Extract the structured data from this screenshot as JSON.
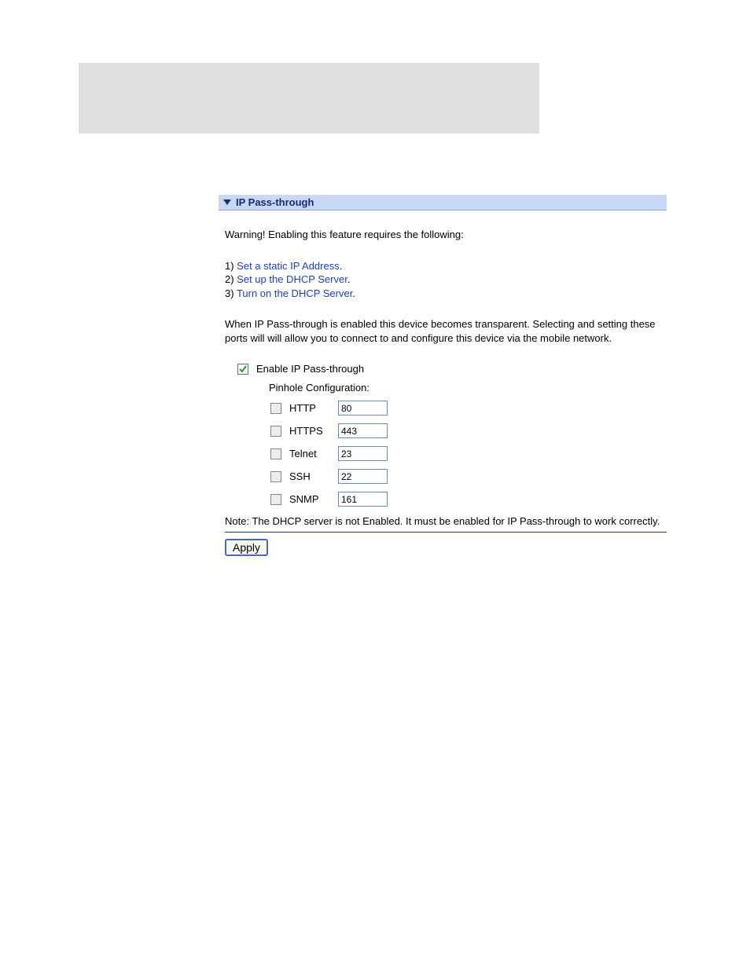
{
  "section": {
    "title": "IP Pass-through"
  },
  "warning": "Warning! Enabling this feature requires the following:",
  "steps": {
    "s1num": "1) ",
    "s1": "Set a static IP Address",
    "s2num": "2) ",
    "s2": "Set up the DHCP Server",
    "s3num": "3) ",
    "s3": "Turn on the DHCP Server",
    "dot": "."
  },
  "description": "When IP Pass-through is enabled this device becomes transparent. Selecting and setting these ports will will allow you to connect to and configure this device via the mobile network.",
  "form": {
    "enable_label": "Enable IP Pass-through",
    "pinhole_label": "Pinhole Configuration:",
    "ports": {
      "http": {
        "name": "HTTP",
        "value": "80"
      },
      "https": {
        "name": "HTTPS",
        "value": "443"
      },
      "telnet": {
        "name": "Telnet",
        "value": "23"
      },
      "ssh": {
        "name": "SSH",
        "value": "22"
      },
      "snmp": {
        "name": "SNMP",
        "value": "161"
      }
    }
  },
  "note": "Note: The DHCP server is not Enabled. It must be enabled for IP Pass-through to work correctly.",
  "apply_label": "Apply"
}
